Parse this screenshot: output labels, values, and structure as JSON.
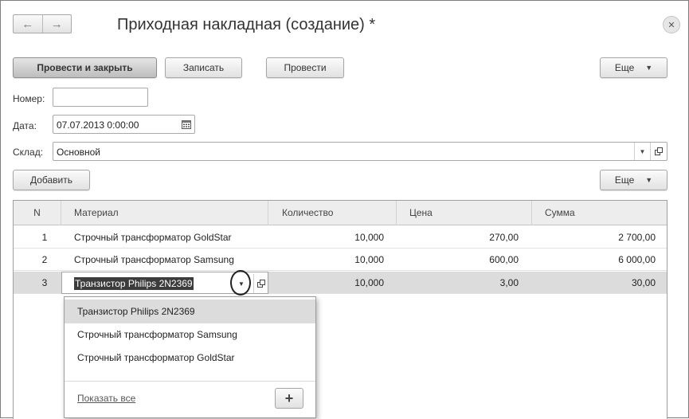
{
  "window": {
    "title": "Приходная накладная (создание) *",
    "nav_back": "←",
    "nav_forward": "→",
    "close": "✕"
  },
  "toolbar": {
    "post_and_close": "Провести и закрыть",
    "write": "Записать",
    "post": "Провести",
    "more": "Еще"
  },
  "form": {
    "number_label": "Номер:",
    "number_value": "",
    "date_label": "Дата:",
    "date_value": "07.07.2013  0:00:00",
    "warehouse_label": "Склад:",
    "warehouse_value": "Основной"
  },
  "table_toolbar": {
    "add": "Добавить",
    "more": "Еще"
  },
  "table": {
    "columns": [
      "N",
      "Материал",
      "Количество",
      "Цена",
      "Сумма"
    ],
    "rows": [
      {
        "n": "1",
        "material": "Строчный трансформатор GoldStar",
        "qty": "10,000",
        "price": "270,00",
        "sum": "2 700,00"
      },
      {
        "n": "2",
        "material": "Строчный трансформатор Samsung",
        "qty": "10,000",
        "price": "600,00",
        "sum": "6 000,00"
      },
      {
        "n": "3",
        "material": "Транзистор Philips 2N2369",
        "qty": "10,000",
        "price": "3,00",
        "sum": "30,00"
      }
    ]
  },
  "dropdown": {
    "items": [
      "Транзистор Philips 2N2369",
      "Строчный трансформатор Samsung",
      "Строчный трансформатор GoldStar"
    ],
    "show_all": "Показать все",
    "add": "+"
  },
  "icons": {
    "arrow_down": "▼",
    "open": "⧉",
    "calendar": "calendar-icon"
  }
}
